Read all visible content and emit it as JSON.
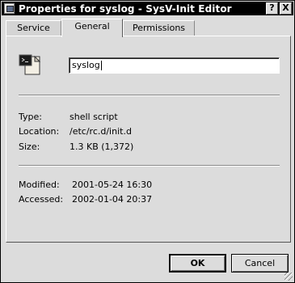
{
  "window": {
    "title": "Properties for syslog - SysV-Init Editor",
    "help_glyph": "?",
    "close_glyph": "X"
  },
  "tabs": [
    {
      "label": "Service",
      "active": false
    },
    {
      "label": "General",
      "active": true
    },
    {
      "label": "Permissions",
      "active": false
    }
  ],
  "general": {
    "icon": "script-file-icon",
    "name_value": "syslog",
    "type_label": "Type:",
    "type_value": "shell script",
    "location_label": "Location:",
    "location_value": "/etc/rc.d/init.d",
    "size_label": "Size:",
    "size_value": "1.3 KB (1,372)",
    "modified_label": "Modified:",
    "modified_value": "2001-05-24 16:30",
    "accessed_label": "Accessed:",
    "accessed_value": "2002-01-04 20:37"
  },
  "buttons": {
    "ok": "OK",
    "cancel": "Cancel"
  }
}
